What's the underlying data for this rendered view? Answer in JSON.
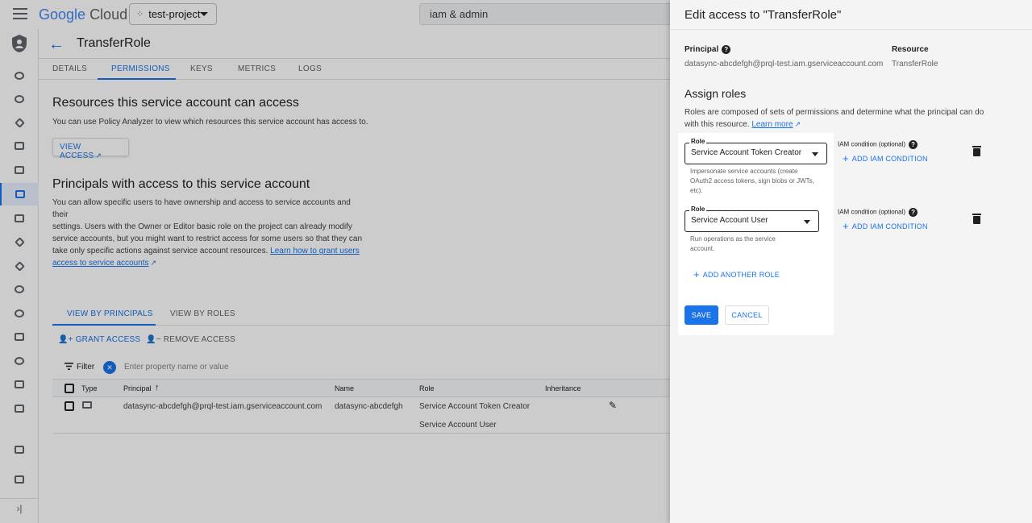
{
  "header": {
    "logo_google": "Google",
    "logo_cloud": "Cloud",
    "project": "test-project",
    "search_value": "iam & admin"
  },
  "page": {
    "title": "TransferRole",
    "tabs": [
      "DETAILS",
      "PERMISSIONS",
      "KEYS",
      "METRICS",
      "LOGS"
    ],
    "active_tab": "PERMISSIONS"
  },
  "resources": {
    "title": "Resources this service account can access",
    "desc": "You can use Policy Analyzer to view which resources this service account has access to.",
    "view_access": "VIEW ACCESS"
  },
  "principals": {
    "title": "Principals with access to this service account",
    "desc_1": "You can allow specific users to have ownership and access to service accounts and their",
    "desc_2": "settings. Users with the Owner or Editor basic role on the project can already modify",
    "desc_3": "service accounts, but you might want to restrict access for some users so that they can",
    "desc_4": "take only specific actions against service account resources.",
    "link_1": "Learn how to grant users",
    "link_2": "access to service accounts",
    "view_tabs": [
      "VIEW BY PRINCIPALS",
      "VIEW BY ROLES"
    ],
    "grant": "GRANT ACCESS",
    "remove": "REMOVE ACCESS",
    "filter_label": "Filter",
    "filter_placeholder": "Enter property name or value"
  },
  "table": {
    "columns": [
      "Type",
      "Principal",
      "Name",
      "Role",
      "Inheritance"
    ],
    "rows": [
      {
        "principal": "datasync-abcdefgh@prql-test.iam.gserviceaccount.com",
        "name": "datasync-abcdefgh",
        "roles": [
          "Service Account Token Creator",
          "Service Account User"
        ]
      }
    ]
  },
  "panel": {
    "title": "Edit access to \"TransferRole\"",
    "principal_label": "Principal",
    "principal_value": "datasync-abcdefgh@prql-test.iam.gserviceaccount.com",
    "resource_label": "Resource",
    "resource_value": "TransferRole",
    "assign_title": "Assign roles",
    "assign_desc": "Roles are composed of sets of permissions and determine what the principal can do with this resource.",
    "learn_more": "Learn more",
    "role_label": "Role",
    "roles": [
      {
        "value": "Service Account Token Creator",
        "help": "Impersonate service accounts (create OAuth2 access tokens, sign blobs or JWTs, etc)."
      },
      {
        "value": "Service Account User",
        "help": "Run operations as the service account."
      }
    ],
    "condition_label": "IAM condition (optional)",
    "condition_btn": "ADD IAM CONDITION",
    "add_role": "ADD ANOTHER ROLE",
    "save": "SAVE",
    "cancel": "CANCEL"
  },
  "icons": {
    "menu": "hamburger-menu-icon",
    "back": "arrow-back-icon",
    "help": "help-circle-icon",
    "delete": "trash-icon",
    "edit": "pencil-icon",
    "dropdown": "caret-down-icon"
  },
  "colors": {
    "accent": "#1a73e8",
    "text": "#202124"
  }
}
